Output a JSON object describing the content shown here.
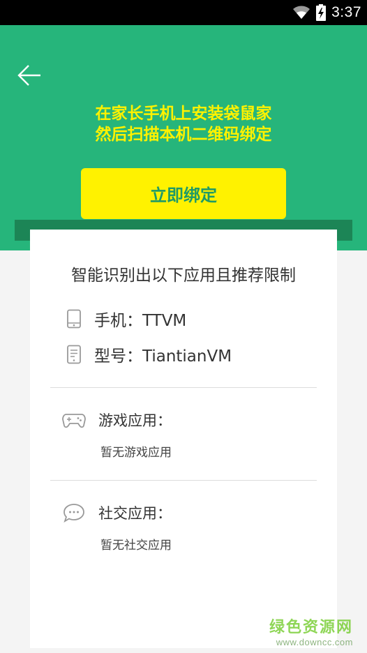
{
  "status_bar": {
    "time": "3:37",
    "icons": [
      "wifi-icon",
      "battery-charging-icon"
    ]
  },
  "header": {
    "back_icon": "back-arrow-icon",
    "title_line1": "在家长手机上安装袋鼠家",
    "title_line2": "然后扫描本机二维码绑定",
    "bind_button": "立即绑定"
  },
  "card": {
    "title": "智能识别出以下应用且推荐限制",
    "phone": {
      "icon": "phone-icon",
      "text": "手机：TTVM"
    },
    "model": {
      "icon": "document-icon",
      "text": "型号：TiantianVM"
    },
    "games": {
      "icon": "gamepad-icon",
      "label": "游戏应用：",
      "empty": "暂无游戏应用"
    },
    "social": {
      "icon": "chat-bubble-icon",
      "label": "社交应用：",
      "empty": "暂无社交应用"
    }
  },
  "watermark": {
    "name": "绿色资源网",
    "url": "www.downcc.com"
  },
  "colors": {
    "primary_green": "#26b57b",
    "dark_green": "#1c8556",
    "accent_yellow": "#fff200"
  }
}
